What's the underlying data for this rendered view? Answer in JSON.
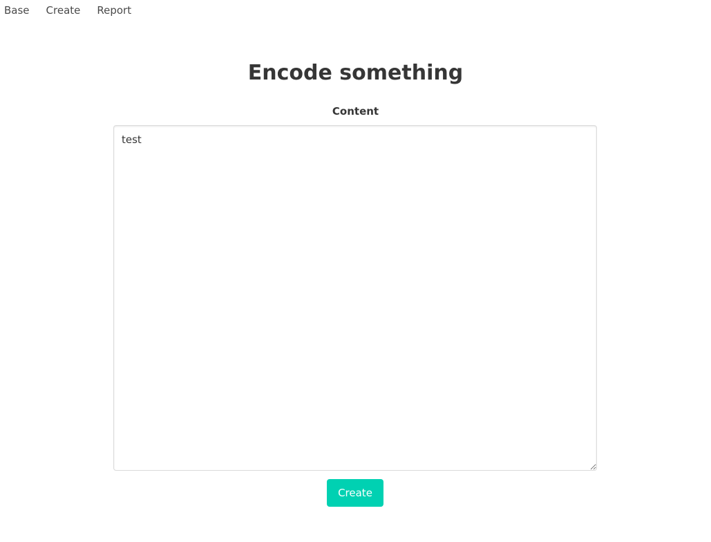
{
  "nav": {
    "items": [
      {
        "label": "Base"
      },
      {
        "label": "Create"
      },
      {
        "label": "Report"
      }
    ]
  },
  "main": {
    "title": "Encode something",
    "content_label": "Content",
    "content_value": "test",
    "submit_label": "Create"
  },
  "colors": {
    "primary": "#00d1b2"
  }
}
